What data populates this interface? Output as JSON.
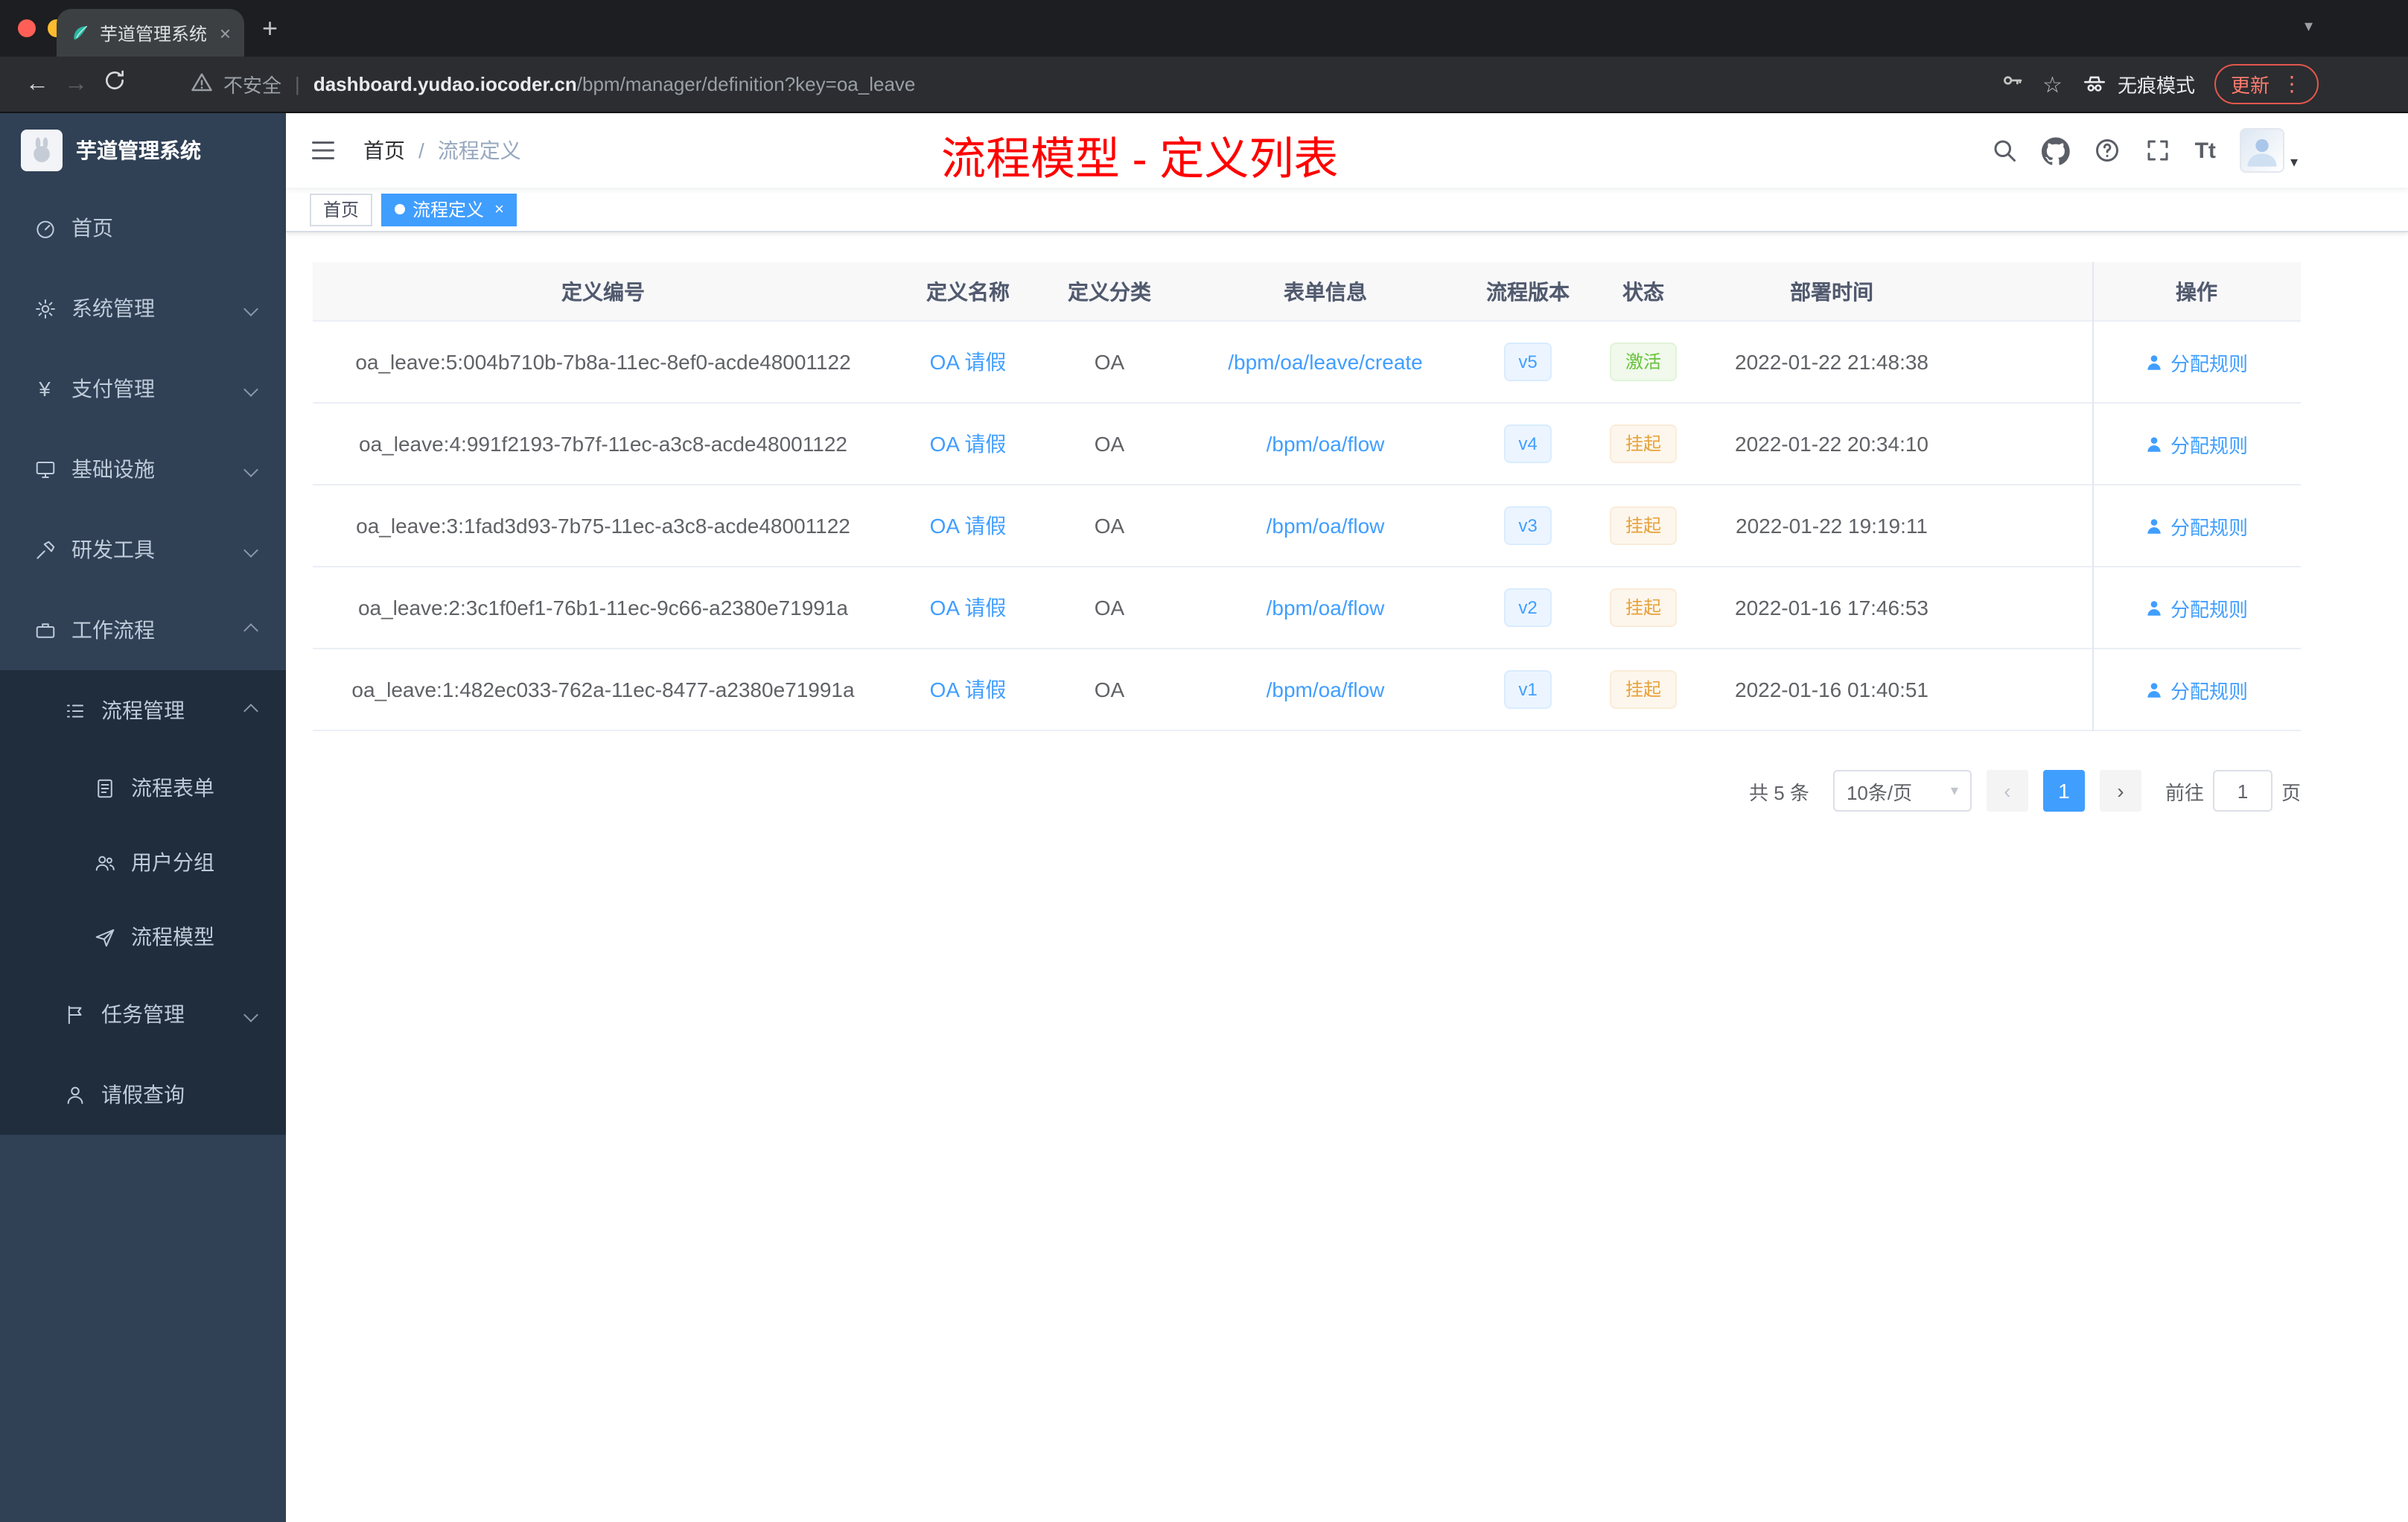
{
  "browser": {
    "tab": {
      "title": "芋道管理系统"
    },
    "toolbar": {
      "security_label": "不安全",
      "url_separator": "|",
      "url_host": "dashboard.yudao.iocoder.cn",
      "url_path": "/bpm/manager/definition?key=oa_leave",
      "incognito_label": "无痕模式",
      "update_label": "更新"
    }
  },
  "icons": {
    "close": "×",
    "plus": "+",
    "kebab": "⋮",
    "caret_down": "▾",
    "chevron_left": "‹",
    "chevron_right": "›",
    "back_arrow": "←",
    "forward_arrow": "→",
    "star": "☆",
    "yen": "¥",
    "question": "?",
    "text_size": "Tt",
    "warning": "▲"
  },
  "sidebar": {
    "logo_title": "芋道管理系统",
    "items": [
      {
        "label": "首页"
      },
      {
        "label": "系统管理"
      },
      {
        "label": "支付管理"
      },
      {
        "label": "基础设施"
      },
      {
        "label": "研发工具"
      },
      {
        "label": "工作流程"
      },
      {
        "label": "流程管理"
      },
      {
        "label": "流程表单"
      },
      {
        "label": "用户分组"
      },
      {
        "label": "流程模型"
      },
      {
        "label": "任务管理"
      },
      {
        "label": "请假查询"
      }
    ]
  },
  "header": {
    "breadcrumb": {
      "home": "首页",
      "separator": "/",
      "current": "流程定义"
    },
    "overlay_title": "流程模型 - 定义列表"
  },
  "tags": {
    "home": "首页",
    "active": "流程定义"
  },
  "table": {
    "columns": {
      "c1": "定义编号",
      "c2": "定义名称",
      "c3": "定义分类",
      "c4": "表单信息",
      "c5": "流程版本",
      "c6": "状态",
      "c7": "部署时间",
      "c8": "操作"
    },
    "rows": [
      {
        "id": "oa_leave:5:004b710b-7b8a-11ec-8ef0-acde48001122",
        "name": "OA 请假",
        "category": "OA",
        "form": "/bpm/oa/leave/create",
        "version": "v5",
        "status": "激活",
        "status_type": "success",
        "time": "2022-01-22 21:48:38",
        "action": "分配规则"
      },
      {
        "id": "oa_leave:4:991f2193-7b7f-11ec-a3c8-acde48001122",
        "name": "OA 请假",
        "category": "OA",
        "form": "/bpm/oa/flow",
        "version": "v4",
        "status": "挂起",
        "status_type": "warning",
        "time": "2022-01-22 20:34:10",
        "action": "分配规则"
      },
      {
        "id": "oa_leave:3:1fad3d93-7b75-11ec-a3c8-acde48001122",
        "name": "OA 请假",
        "category": "OA",
        "form": "/bpm/oa/flow",
        "version": "v3",
        "status": "挂起",
        "status_type": "warning",
        "time": "2022-01-22 19:19:11",
        "action": "分配规则"
      },
      {
        "id": "oa_leave:2:3c1f0ef1-76b1-11ec-9c66-a2380e71991a",
        "name": "OA 请假",
        "category": "OA",
        "form": "/bpm/oa/flow",
        "version": "v2",
        "status": "挂起",
        "status_type": "warning",
        "time": "2022-01-16 17:46:53",
        "action": "分配规则"
      },
      {
        "id": "oa_leave:1:482ec033-762a-11ec-8477-a2380e71991a",
        "name": "OA 请假",
        "category": "OA",
        "form": "/bpm/oa/flow",
        "version": "v1",
        "status": "挂起",
        "status_type": "warning",
        "time": "2022-01-16 01:40:51",
        "action": "分配规则"
      }
    ]
  },
  "pagination": {
    "total": "共 5 条",
    "page_size": "10条/页",
    "current_page": "1",
    "goto_label": "前往",
    "goto_value": "1",
    "unit_label": "页"
  },
  "colors": {
    "accent_blue": "#409eff",
    "success_green": "#67c23a",
    "warning_orange": "#e6a23c",
    "title_red": "#ff0000",
    "sidebar_bg": "#304156",
    "sidebar_sub_bg": "#1f2d3d"
  }
}
